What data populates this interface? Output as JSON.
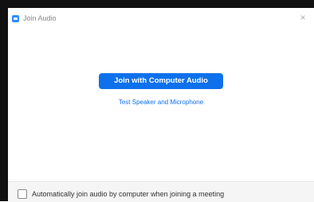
{
  "window": {
    "title": "Join Audio",
    "close_glyph": "×"
  },
  "main": {
    "join_button_label": "Join with Computer Audio",
    "test_link_label": "Test Speaker and Microphone"
  },
  "footer": {
    "auto_join_label": "Automatically join audio by computer when joining a meeting",
    "auto_join_checked": false
  },
  "colors": {
    "accent": "#0e71eb",
    "app_icon": "#2d8cff"
  },
  "icons": {
    "app": "zoom-camera-icon",
    "close": "close-icon"
  }
}
